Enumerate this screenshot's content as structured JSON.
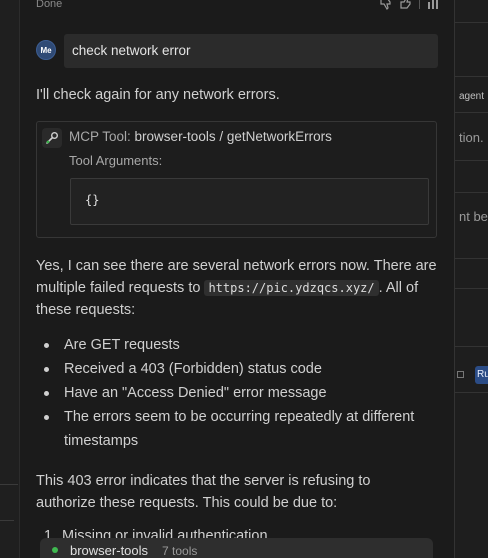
{
  "header": {
    "status": "Done",
    "icons": [
      "thumbs-down-icon",
      "thumbs-up-icon",
      "chart-icon"
    ]
  },
  "user_message": {
    "avatar": "Me",
    "text": "check network error"
  },
  "assistant": {
    "intro": "I'll check again for any network errors.",
    "tool_call": {
      "prefix": "MCP Tool:",
      "name": "browser-tools / getNetworkErrors",
      "args_label": "Tool Arguments:",
      "args_value": "{}"
    },
    "para1_before": "Yes, I can see there are several network errors now. There are multiple failed requests to ",
    "para1_code": "https://pic.ydzqcs.xyz/",
    "para1_after": ". All of these requests:",
    "bullets": [
      "Are GET requests",
      "Received a 403 (Forbidden) status code",
      "Have an \"Access Denied\" error message",
      "The errors seem to be occurring repeatedly at different timestamps"
    ],
    "para2": "This 403 error indicates that the server is refusing to authorize these requests. This could be due to:",
    "ordered_partial": {
      "number": "1.",
      "text": "Missing or invalid authentication"
    }
  },
  "status_bar": {
    "server_name": "browser-tools",
    "tool_count": "7 tools",
    "status_color": "#3fb950"
  },
  "right_pane": {
    "text_agent": "agent",
    "text_tion": "tion.",
    "text_ntbe": "nt be",
    "run_label": "Ru"
  },
  "colors": {
    "background": "#1b1b1b",
    "avatar": "#2f4a75",
    "run_badge": "#2b4c86"
  }
}
